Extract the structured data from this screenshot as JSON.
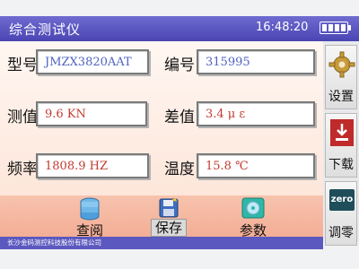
{
  "app": {
    "title": "综合测试仪",
    "time": "16:48:20"
  },
  "fields": {
    "model": {
      "label": "型号",
      "value": "JMZX3820AAT"
    },
    "serial": {
      "label": "编号",
      "value": "315995"
    },
    "measured": {
      "label": "测值",
      "value": "9.6  KN"
    },
    "difference": {
      "label": "差值",
      "value": "3.4 μ  ε"
    },
    "frequency": {
      "label": "频率",
      "value": "1808.9   HZ"
    },
    "temperature": {
      "label": "温度",
      "value": "15.8  ℃"
    }
  },
  "bottom_buttons": {
    "query": "查阅",
    "save": "保存",
    "params": "参数"
  },
  "side_buttons": {
    "settings": "设置",
    "download": "下载",
    "zero_icon": "zero",
    "zero": "调零"
  },
  "footer": {
    "company": "长沙金码测控科技股份有限公司"
  },
  "colors": {
    "titlebar": "#5450be",
    "value_blue": "#4f62c2",
    "value_red": "#c23a30",
    "bottom_bar": "#f3ae96"
  }
}
